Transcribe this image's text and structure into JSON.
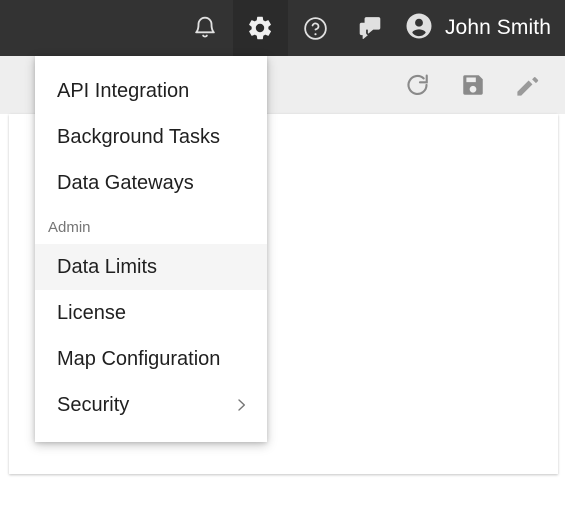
{
  "topbar": {
    "background_color": "#333333",
    "active_background_color": "#2b2b2b",
    "icon_color": "#e0e0e0",
    "actions": [
      {
        "name": "notifications",
        "icon": "bell-icon",
        "label": "Notifications",
        "active": false
      },
      {
        "name": "settings",
        "icon": "gear-icon",
        "label": "Settings",
        "active": true
      },
      {
        "name": "help",
        "icon": "help-circle-icon",
        "label": "Help",
        "active": false
      },
      {
        "name": "messages",
        "icon": "forum-icon",
        "label": "Messages",
        "active": false
      }
    ],
    "user": {
      "name": "John Smith",
      "avatar_icon": "account-circle-icon"
    }
  },
  "toolbar": {
    "background_color": "#eeeeee",
    "icon_color": "#8a8a8a",
    "actions": [
      {
        "name": "refresh",
        "icon": "refresh-icon",
        "label": "Refresh"
      },
      {
        "name": "save",
        "icon": "save-icon",
        "label": "Save"
      },
      {
        "name": "edit",
        "icon": "pencil-icon",
        "label": "Edit"
      }
    ]
  },
  "settings_menu": {
    "background_color": "#ffffff",
    "highlight_color": "#f5f5f5",
    "text_color": "#1f1f1f",
    "section_label_color": "#757575",
    "items": [
      {
        "label": "API Integration",
        "type": "item",
        "highlighted": false,
        "submenu": false
      },
      {
        "label": "Background Tasks",
        "type": "item",
        "highlighted": false,
        "submenu": false
      },
      {
        "label": "Data Gateways",
        "type": "item",
        "highlighted": false,
        "submenu": false
      },
      {
        "label": "Admin",
        "type": "section-header"
      },
      {
        "label": "Data Limits",
        "type": "item",
        "highlighted": true,
        "submenu": false
      },
      {
        "label": "License",
        "type": "item",
        "highlighted": false,
        "submenu": false
      },
      {
        "label": "Map Configuration",
        "type": "item",
        "highlighted": false,
        "submenu": false
      },
      {
        "label": "Security",
        "type": "item",
        "highlighted": false,
        "submenu": true,
        "submenu_icon": "chevron-right-icon"
      }
    ]
  }
}
